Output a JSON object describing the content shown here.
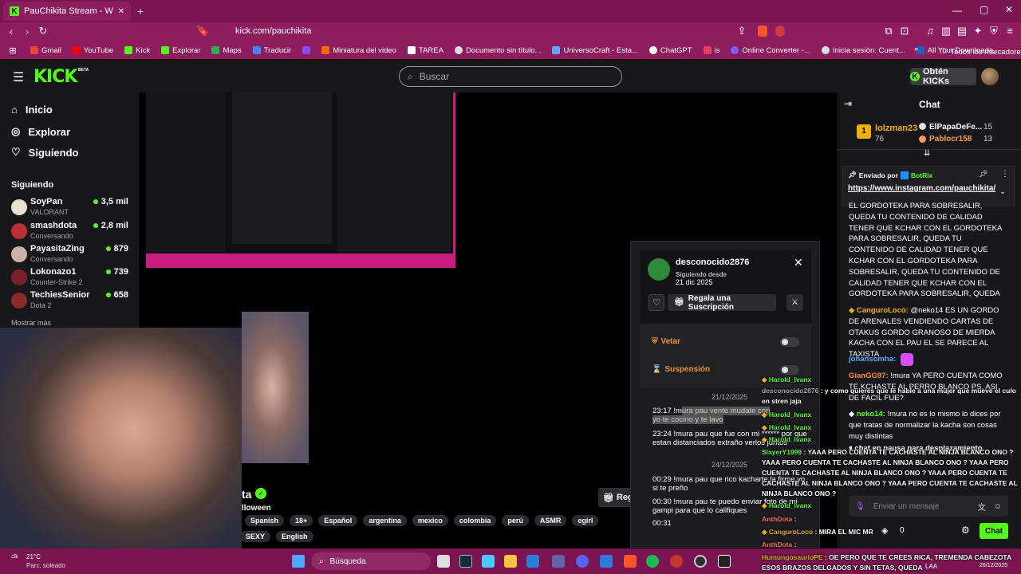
{
  "browser": {
    "tab_title": "PauChikita Stream - Watch Live o",
    "new_tab": "+",
    "url": "kick.com/pauchikita",
    "bookmarks": [
      "Gmail",
      "YouTube",
      "Kick",
      "Explorar",
      "Maps",
      "Traducir",
      "",
      "Miniatura del video",
      "TAREA",
      "Documento sin título...",
      "UniversoCraft - Esta...",
      "ChatGPT",
      "is",
      "Online Converter -...",
      "Inicia sesión: Cuent...",
      "All Your Downloada..."
    ],
    "bookmarks_more": "»",
    "all_bookmarks": "Todos los marcadores"
  },
  "kick": {
    "logo": "KICK",
    "search_placeholder": "Buscar",
    "get_kicks": "Obtén KICKs"
  },
  "sidebar": {
    "nav": [
      {
        "label": "Inicio",
        "icon": "home-icon"
      },
      {
        "label": "Explorar",
        "icon": "compass-icon"
      },
      {
        "label": "Siguiendo",
        "icon": "heart-icon"
      }
    ],
    "following_header": "Siguiendo",
    "following": [
      {
        "name": "SoyPan",
        "sub": "VALORANT",
        "count": "3,5 mil"
      },
      {
        "name": "smashdota",
        "sub": "Conversando",
        "count": "2,8 mil"
      },
      {
        "name": "PayasitaZing",
        "sub": "Conversando",
        "count": "879"
      },
      {
        "name": "Lokonazo1",
        "sub": "Counter-Strike 2",
        "count": "739"
      },
      {
        "name": "TechiesSenior",
        "sub": "Dota 2",
        "count": "658"
      }
    ],
    "show_more": "Mostrar más"
  },
  "stream": {
    "streamer_partial": "ta",
    "subtitle_partial": "lloween",
    "tags": [
      "Spanish",
      "18+",
      "Español",
      "argentina",
      "mexico",
      "colombia",
      "perú",
      "ASMR",
      "egirl"
    ],
    "tags2": [
      "SEXY",
      "English"
    ],
    "gift_partial": "Reg"
  },
  "popup": {
    "username": "desconocido2876",
    "following_since_label": "Siguiendo desde",
    "following_since": "21 dic 2025",
    "gift_sub": "Regala una Suscripción",
    "ban_label": "Vetar",
    "timeout_label": "Suspensión",
    "date1": "21/12/2025",
    "date2": "24/12/2025",
    "msgs": [
      {
        "t": "23:17 !m",
        "rest": "ura pau vente mudate con",
        "extra": "yo te cocino y te lavo"
      },
      {
        "t": "23:24 !mura pau que fue con mi ****** por que estan distanciados extraño verlos juntos"
      },
      {
        "t": "00:29 !mura pau que rico kacharte la firme yo si te preño"
      },
      {
        "t": "00:30 !mura pau te puedo enviar foto de mi gampi para que lo califiques"
      },
      {
        "t": "00:31"
      }
    ]
  },
  "chat": {
    "title": "Chat",
    "leaderboard": [
      {
        "name": "lolzman23",
        "value": "76"
      },
      {
        "name": "ElPapaDeFe...",
        "value": "15"
      },
      {
        "name": "Pablocr158",
        "value": "13"
      }
    ],
    "pinned_by": "Enviado por",
    "pinned_user": "BotRix",
    "pinned_link": "https://www.instagram.com/pauchikita/",
    "messages": [
      {
        "user": "",
        "text": "EL GORDOTEKA PARA SOBRESALIR, QUEDA TU CONTENIDO DE CALIDAD TENER QUE KCHAR CON EL GORDOTEKA PARA SOBRESALIR, QUEDA TU CONTENIDO DE CALIDAD TENER QUE KCHAR CON EL GORDOTEKA PARA SOBRESALIR, QUEDA TU CONTENIDO DE CALIDAD TENER QUE KCHAR CON EL GORDOTEKA PARA SOBRESALIR, QUEDA TU CONTENIDO DE CALIDAD"
      },
      {
        "user": "CanguroLoco:",
        "text": "@neko14 ES UN GORDO DE ARENALES VENDIENDO CARTAS DE OTAKUS GORDO GRANOSO DE MIERDA KACHA CON EL PAU EL SE PARECE AL TAXISTA"
      },
      {
        "user": "johansomha:",
        "text": ""
      },
      {
        "user": "GianGG97:",
        "text": "!mura YA PERO CUENTA COMO TE KCHASTE AL PERRO BLANCO PS, ASI DE FACIL FUE?"
      },
      {
        "user": "neko14:",
        "text": "!mura no es lo mismo lo dices por que tratas de normalizar la kacha son cosas muy distintas"
      },
      {
        "user": "",
        "text": "chat en pausa para desplazamiento"
      }
    ],
    "input_placeholder": "Enviar un mensaje",
    "points": "0",
    "send": "Chat"
  },
  "overlay": [
    {
      "user": "Harold_Ivanx",
      "text": ""
    },
    {
      "user": "desconocido2876",
      "text": ": y como quieres que le hable a una mujer que mueve el culo en stren jaja"
    },
    {
      "user": "Harold_Ivanx",
      "text": ""
    },
    {
      "user": "Harold_Ivanx",
      "text": ""
    },
    {
      "user": "Harold_Ivanx",
      "text": ""
    },
    {
      "user": "SlayerY1999",
      "text": ": YAAA PERO CUENTA TE CACHASTE AL NINJA BLANCO ONO ? YAAA PERO CUENTA TE CACHASTE AL NINJA BLANCO ONO ? YAAA PERO CUENTA TE CACHASTE AL NINJA BLANCO ONO ? YAAA PERO CUENTA TE CACHASTE AL NINJA BLANCO ONO ? YAAA PERO CUENTA TE CACHASTE AL NINJA BLANCO ONO ?"
    },
    {
      "user": "Harold_Ivanx",
      "text": ""
    },
    {
      "user": "AnthDota",
      "text": ":"
    },
    {
      "user": "CanguroLoco",
      "text": ": MIRA EL MIC MR"
    },
    {
      "user": "AnthDota",
      "text": ":"
    },
    {
      "user": "HumungosaurioPE",
      "text": ": OE PERO QUE TE CREES RICA, TREMENDA CABEZOTA ESOS BRAZOS DELGADOS Y SIN TETAS, QUEDA"
    }
  ],
  "taskbar": {
    "weather": "21°C",
    "weather_desc": "Parc. soleado",
    "search": "Búsqueda",
    "lang": "LAA",
    "date": "26/12/2025"
  },
  "colors": {
    "kick_green": "#53fc18",
    "chrome_magenta": "#8e1d60"
  }
}
